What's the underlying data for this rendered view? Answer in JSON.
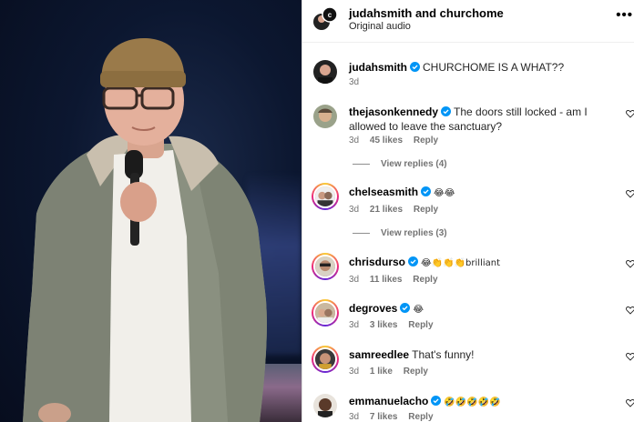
{
  "header": {
    "title": "judahsmith and churchome",
    "subtitle": "Original audio",
    "more_icon": "•••"
  },
  "comments": [
    {
      "user": "judahsmith",
      "text": "CHURCHOME IS A WHAT??",
      "age": "3d",
      "likes": "",
      "reply": ""
    },
    {
      "user": "thejasonkennedy",
      "text": "The doors still locked - am I allowed to leave the sanctuary?",
      "age": "3d",
      "likes": "45 likes",
      "reply": "Reply",
      "view_replies": "View replies (4)"
    },
    {
      "user": "chelseasmith",
      "text": "😂😂",
      "age": "3d",
      "likes": "21 likes",
      "reply": "Reply",
      "view_replies": "View replies (3)"
    },
    {
      "user": "chrisdurso",
      "text": "😂👏👏👏brilliant",
      "age": "3d",
      "likes": "11 likes",
      "reply": "Reply"
    },
    {
      "user": "degroves",
      "text": "😂",
      "age": "3d",
      "likes": "3 likes",
      "reply": "Reply"
    },
    {
      "user": "samreedlee",
      "text": "That's funny!",
      "age": "3d",
      "likes": "1 like",
      "reply": "Reply"
    },
    {
      "user": "emmanuelacho",
      "text": "🤣🤣🤣🤣🤣",
      "age": "3d",
      "likes": "7 likes",
      "reply": "Reply"
    }
  ],
  "colors": {
    "verified": "#0095f6",
    "meta_text": "#737373",
    "video_bg": "#0c1730",
    "story_ring": "#ee2a7b"
  }
}
